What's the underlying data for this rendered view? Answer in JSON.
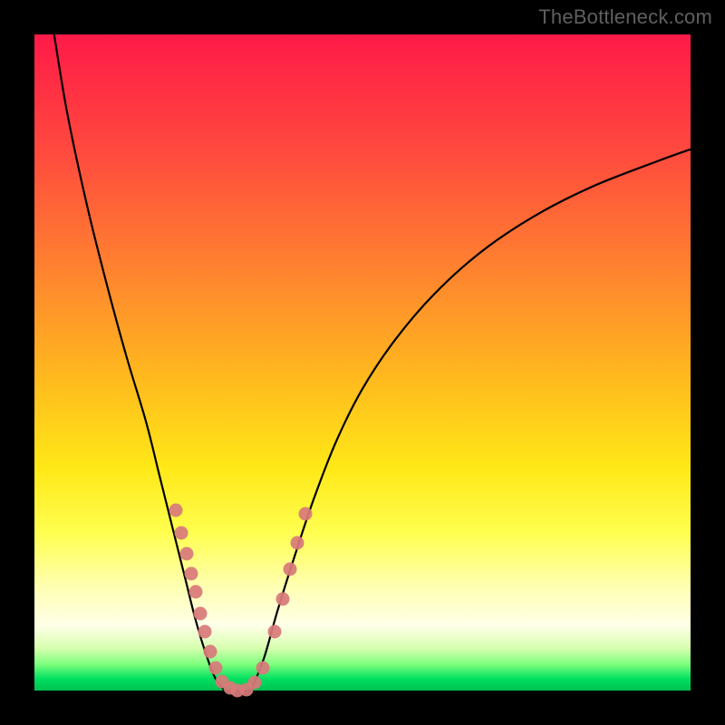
{
  "watermark": "TheBottleneck.com",
  "colors": {
    "frame": "#000000",
    "dot": "#d87a7a",
    "curve": "#000000"
  },
  "chart_data": {
    "type": "line",
    "title": "",
    "xlabel": "",
    "ylabel": "",
    "xlim": [
      0,
      100
    ],
    "ylim": [
      0,
      100
    ],
    "grid": false,
    "legend": false,
    "curve_left": {
      "x": [
        3,
        5,
        8,
        11,
        14,
        17,
        19,
        21,
        23,
        24.5,
        26,
        27.5,
        29
      ],
      "y": [
        100,
        88,
        74,
        62,
        51,
        41,
        33,
        25,
        17,
        11,
        6,
        2,
        0
      ]
    },
    "curve_right": {
      "x": [
        33,
        35,
        37,
        39.5,
        42.5,
        46,
        50,
        55,
        61,
        68,
        76,
        85,
        95,
        100
      ],
      "y": [
        0,
        5,
        12,
        20,
        29,
        38,
        46,
        53.5,
        60.5,
        66.8,
        72.2,
        76.8,
        80.7,
        82.5
      ]
    },
    "flat_bottom": {
      "x": [
        29,
        33
      ],
      "y": [
        0,
        0
      ]
    },
    "dots": [
      {
        "x": 21.5,
        "y": 27.5
      },
      {
        "x": 22.4,
        "y": 24.0
      },
      {
        "x": 23.2,
        "y": 20.8
      },
      {
        "x": 23.9,
        "y": 17.8
      },
      {
        "x": 24.6,
        "y": 15.0
      },
      {
        "x": 25.3,
        "y": 11.8
      },
      {
        "x": 26.0,
        "y": 9.0
      },
      {
        "x": 26.8,
        "y": 6.0
      },
      {
        "x": 27.6,
        "y": 3.4
      },
      {
        "x": 28.6,
        "y": 1.4
      },
      {
        "x": 29.8,
        "y": 0.4
      },
      {
        "x": 31.0,
        "y": 0.0
      },
      {
        "x": 32.3,
        "y": 0.2
      },
      {
        "x": 33.6,
        "y": 1.2
      },
      {
        "x": 34.8,
        "y": 3.5
      },
      {
        "x": 36.6,
        "y": 9.0
      },
      {
        "x": 37.8,
        "y": 14.0
      },
      {
        "x": 39.0,
        "y": 18.5
      },
      {
        "x": 40.0,
        "y": 22.5
      },
      {
        "x": 41.3,
        "y": 27.0
      }
    ]
  }
}
